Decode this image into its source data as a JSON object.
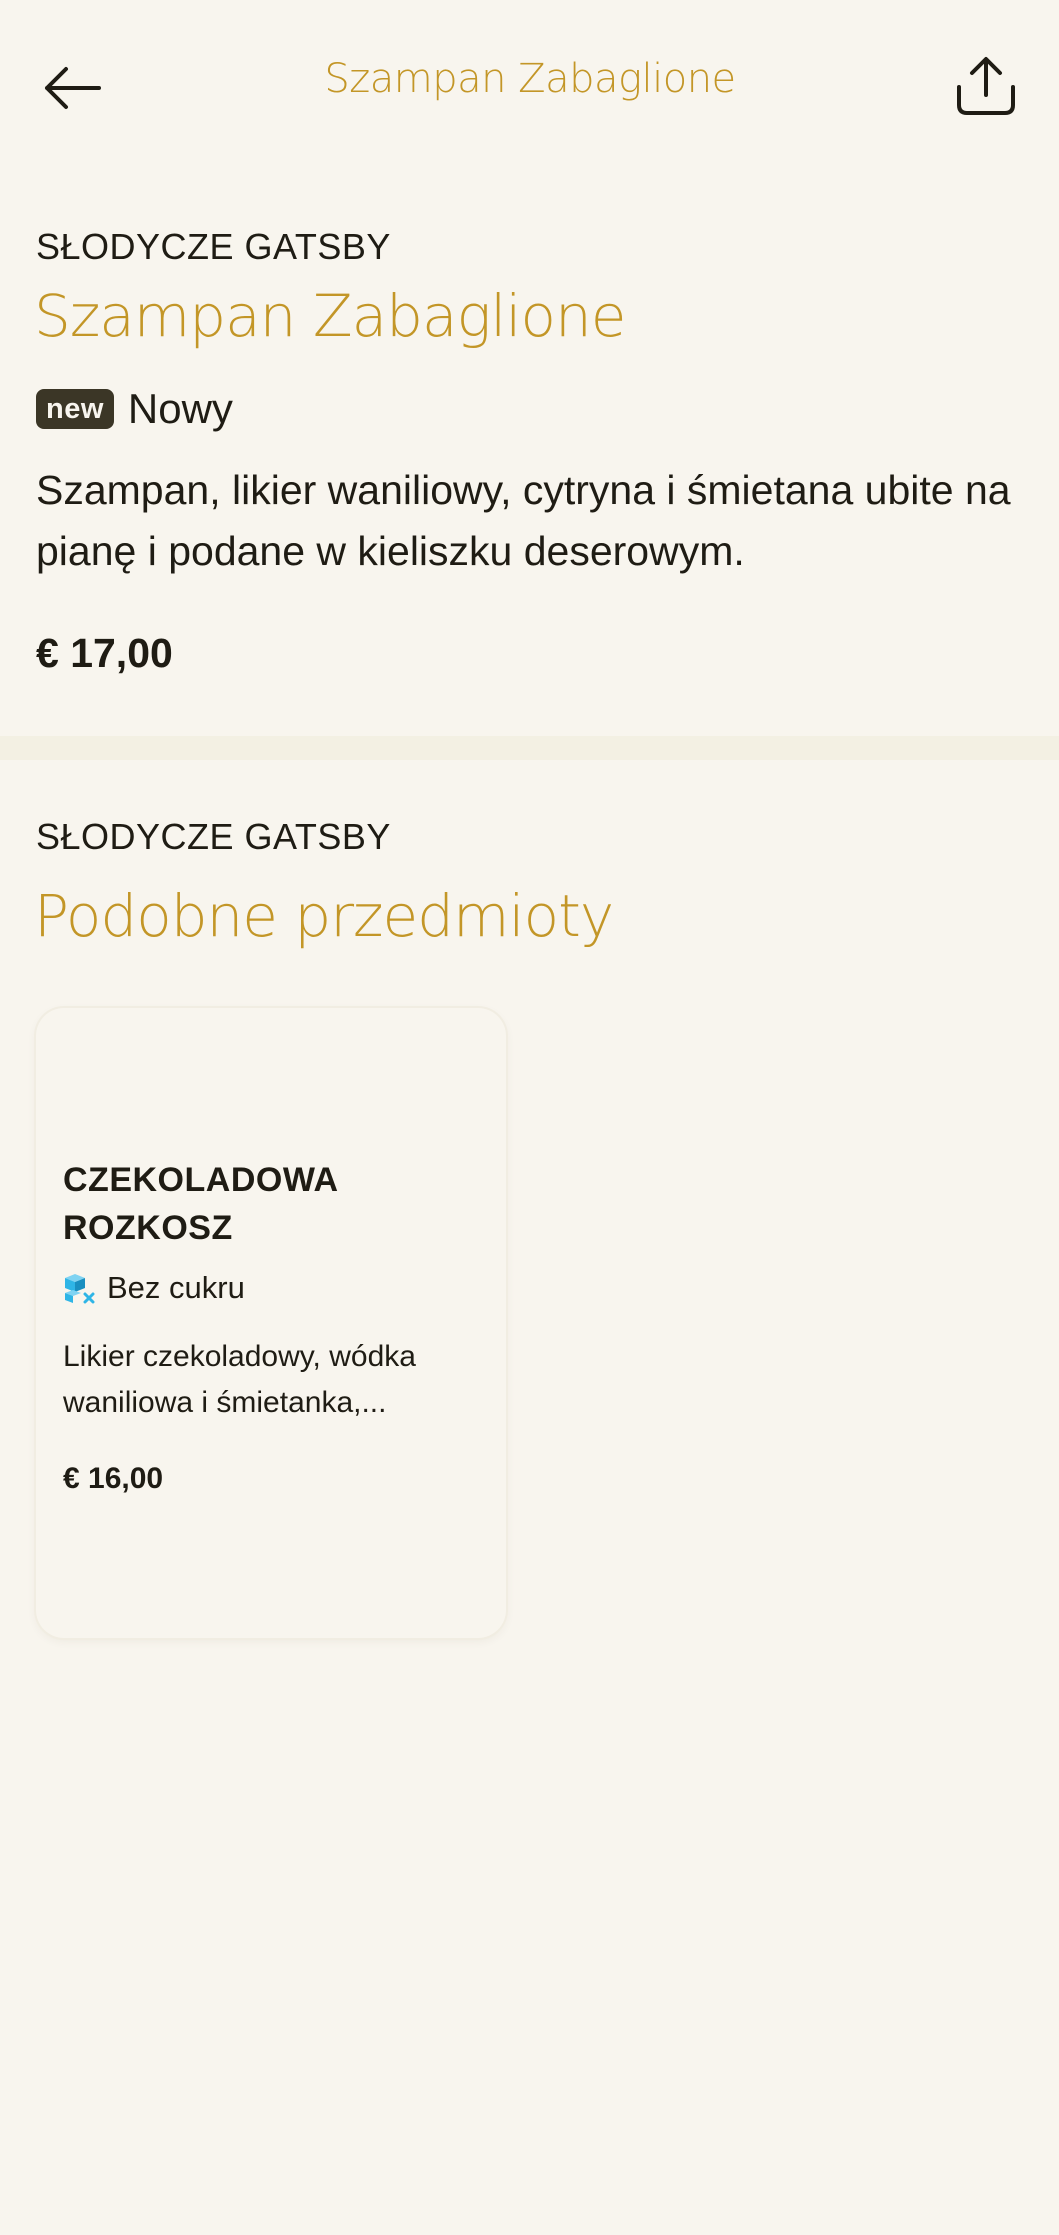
{
  "header": {
    "title": "Szampan Zabaglione",
    "back_icon": "arrow-left-icon",
    "share_icon": "share-upload-icon"
  },
  "product": {
    "category": "SŁODYCZE GATSBY",
    "name": "Szampan Zabaglione",
    "badge": "new",
    "badge_label": "Nowy",
    "description": "Szampan, likier waniliowy, cytryna i śmietana ubite na pianę i podane w kieliszku deserowym.",
    "price": "€ 17,00"
  },
  "similar": {
    "category": "SŁODYCZE GATSBY",
    "heading": "Podobne przedmioty",
    "items": [
      {
        "name": "CZEKOLADOWA ROZKOSZ",
        "tag_icon": "sugar-free-icon",
        "tag_label": "Bez cukru",
        "description": "Likier czekoladowy, wódka waniliowa i śmietanka,...",
        "price": "€ 16,00"
      }
    ]
  },
  "colors": {
    "background": "#f8f5ee",
    "accent": "#c39627",
    "text": "#1f1c14",
    "badge_bg": "#3b3626",
    "divider": "#f3f0e3",
    "sugar_free_icon": "#2fb5e6"
  }
}
